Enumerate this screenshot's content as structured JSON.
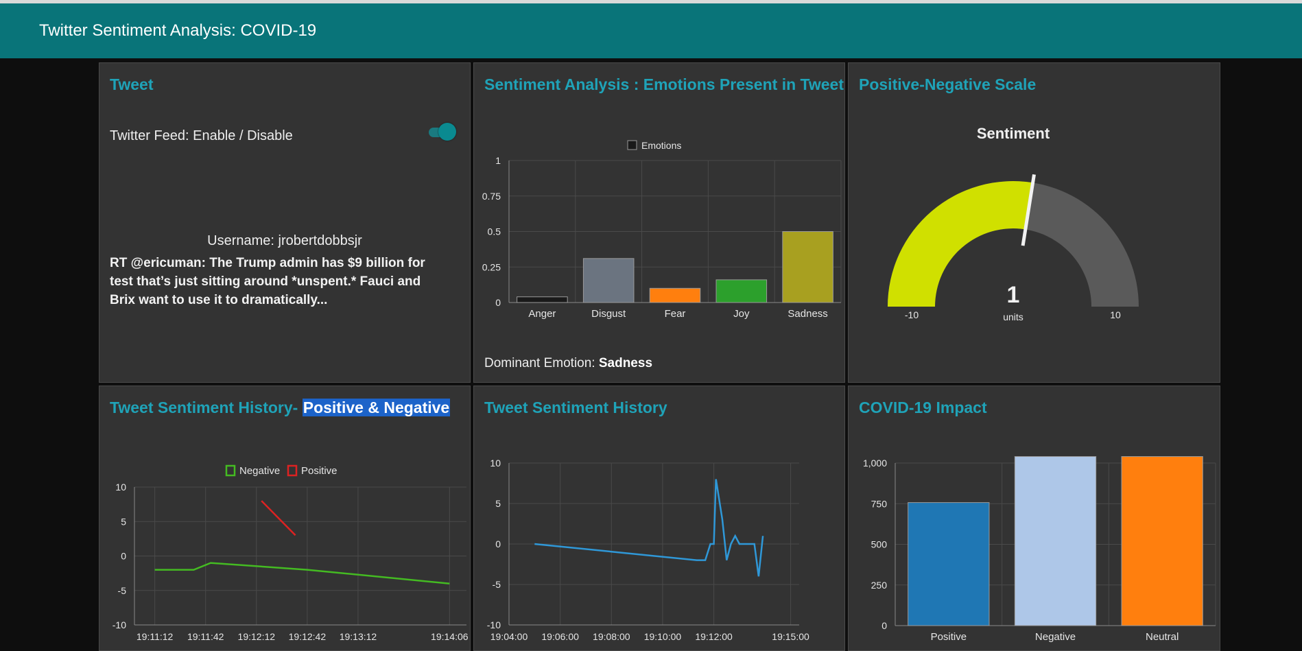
{
  "header": {
    "title": "Twitter Sentiment Analysis: COVID-19"
  },
  "tweet_panel": {
    "title": "Tweet",
    "toggle_label": "Twitter Feed: Enable / Disable",
    "toggle_on": true,
    "username": "Username: jrobertdobbsjr",
    "text": "RT @ericuman: The Trump admin has $9 billion for test that’s just sitting around *unspent.* Fauci and Brix want to use it to dramatically..."
  },
  "emotion_panel": {
    "title": "Sentiment Analysis : Emotions Present in Tweet",
    "dominant_label": "Dominant Emotion:",
    "dominant_value": "Sadness"
  },
  "gauge_panel": {
    "title": "Positive-Negative Scale",
    "gauge_title": "Sentiment",
    "value_text": "1",
    "units": "units",
    "min_label": "-10",
    "max_label": "10",
    "value": 1,
    "min": -10,
    "max": 10,
    "fill_color": "#d0e000",
    "track_color": "#5a5a5a"
  },
  "history_pn_panel": {
    "title_main": "Tweet Sentiment History-",
    "title_highlight": "Positive & Negative"
  },
  "history_panel": {
    "title": "Tweet Sentiment History"
  },
  "impact_panel": {
    "title": "COVID-19 Impact"
  },
  "chart_data": [
    {
      "type": "bar",
      "legend": [
        "Emotions"
      ],
      "categories": [
        "Anger",
        "Disgust",
        "Fear",
        "Joy",
        "Sadness"
      ],
      "values": [
        0.04,
        0.31,
        0.1,
        0.16,
        0.5
      ],
      "colors": [
        "#1a1a1a",
        "#6b7480",
        "#ff7f0e",
        "#2ca02c",
        "#a8a020"
      ],
      "ylim": [
        0,
        1
      ],
      "yticks": [
        "0",
        "0.25",
        "0.5",
        "0.75",
        "1"
      ],
      "grid": true
    },
    {
      "type": "line",
      "legend": [
        "Negative",
        "Positive"
      ],
      "xticks": [
        "19:11:12",
        "19:11:42",
        "19:12:12",
        "19:12:42",
        "19:13:12",
        "19:14:06"
      ],
      "yticks": [
        "10",
        "5",
        "0",
        "-5",
        "-10"
      ],
      "ylim": [
        -10,
        10
      ],
      "series": [
        {
          "name": "Negative",
          "color": "#44bb22",
          "points": [
            [
              "19:11:12",
              -2
            ],
            [
              "19:11:35",
              -2
            ],
            [
              "19:11:45",
              -1
            ],
            [
              "19:12:42",
              -2
            ],
            [
              "19:14:06",
              -4
            ]
          ]
        },
        {
          "name": "Positive",
          "color": "#dd2222",
          "points": [
            [
              "19:12:15",
              8
            ],
            [
              "19:12:35",
              3
            ]
          ]
        }
      ],
      "grid": true
    },
    {
      "type": "line",
      "xticks": [
        "19:04:00",
        "19:06:00",
        "19:08:00",
        "19:10:00",
        "19:12:00",
        "19:15:00"
      ],
      "yticks": [
        "10",
        "5",
        "0",
        "-5",
        "-10"
      ],
      "ylim": [
        -10,
        10
      ],
      "series": [
        {
          "color": "#2f98d8",
          "points": [
            [
              "19:05:00",
              0
            ],
            [
              "19:11:20",
              -2
            ],
            [
              "19:11:40",
              -2
            ],
            [
              "19:11:52",
              0
            ],
            [
              "19:12:00",
              0
            ],
            [
              "19:12:05",
              8
            ],
            [
              "19:12:20",
              3
            ],
            [
              "19:12:30",
              -2
            ],
            [
              "19:12:40",
              0
            ],
            [
              "19:12:50",
              1
            ],
            [
              "19:13:00",
              0
            ],
            [
              "19:13:10",
              0
            ],
            [
              "19:13:35",
              0
            ],
            [
              "19:13:45",
              -4
            ],
            [
              "19:13:55",
              1
            ]
          ]
        }
      ],
      "grid": true
    },
    {
      "type": "bar",
      "categories": [
        "Positive",
        "Negative",
        "Neutral"
      ],
      "values": [
        757,
        1040,
        1040
      ],
      "colors": [
        "#1f77b4",
        "#aec7e8",
        "#ff7f0e"
      ],
      "ylim": [
        0,
        1000
      ],
      "yticks": [
        "0",
        "250",
        "500",
        "750",
        "1,000"
      ],
      "grid": true
    }
  ]
}
